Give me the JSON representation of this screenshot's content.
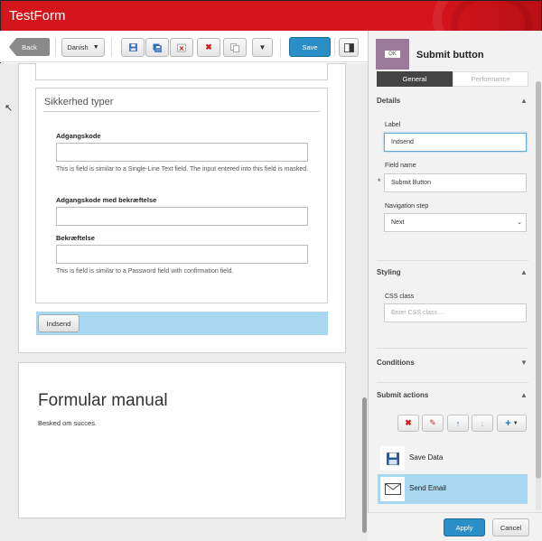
{
  "app": {
    "title": "TestForm"
  },
  "toolbar": {
    "back_label": "Back",
    "language": "Danish",
    "save_label": "Save"
  },
  "form": {
    "group_title": "Sikkerhed typer",
    "fields": [
      {
        "label": "Adgangskode",
        "help": "This is field is similar to a Single-Line Text field. The input entered into this field is masked."
      },
      {
        "label": "Adgangskode med bekræftelse"
      },
      {
        "label": "Bekræftelse",
        "help": "This is field is similar to a Password field with confirmation field."
      }
    ],
    "submit_label": "Indsend"
  },
  "manual": {
    "title": "Formular manual",
    "text": "Besked om succes."
  },
  "panel": {
    "title": "Submit button",
    "icon_text": "OK",
    "tabs": [
      "General",
      "Performance"
    ],
    "details": {
      "heading": "Details",
      "label_caption": "Label",
      "label_value": "Indsend",
      "fieldname_caption": "Field name",
      "fieldname_value": "Submit Button",
      "navstep_caption": "Navigation step",
      "navstep_value": "Next"
    },
    "styling": {
      "heading": "Styling",
      "css_caption": "CSS class",
      "css_placeholder": "Enter CSS class ..."
    },
    "conditions_heading": "Conditions",
    "actions": {
      "heading": "Submit actions",
      "items": [
        {
          "label": "Save Data",
          "icon": "floppy-disk-icon"
        },
        {
          "label": "Send Email",
          "icon": "envelope-icon",
          "selected": true
        }
      ]
    },
    "apply_label": "Apply",
    "cancel_label": "Cancel"
  },
  "colors": {
    "title_bar": "#d4151b",
    "primary_button": "#2a8fc6",
    "selection": "#a8d8ef"
  }
}
